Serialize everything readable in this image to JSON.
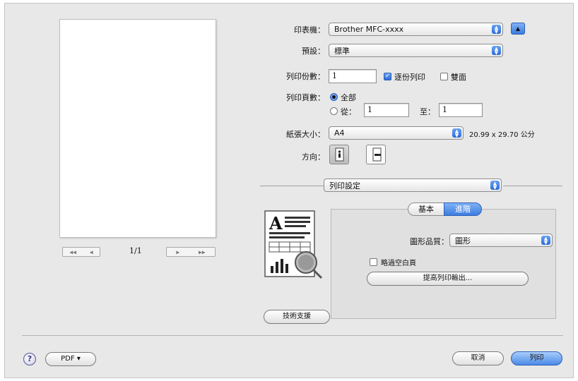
{
  "printer": {
    "label": "印表機：",
    "value": "Brother MFC-xxxx"
  },
  "presets": {
    "label": "預設：",
    "value": "標準"
  },
  "copies": {
    "label": "列印份數：",
    "value": "1",
    "collate_label": "逐份列印",
    "collate_checked": true,
    "duplex_label": "雙面",
    "duplex_checked": false
  },
  "pages": {
    "label": "列印頁數：",
    "all_label": "全部",
    "from_label": "從：",
    "from_value": "1",
    "to_label": "至：",
    "to_value": "1",
    "selected": "all"
  },
  "paper_size": {
    "label": "紙張大小：",
    "value": "A4",
    "dimensions": "20.99 x 29.70 公分"
  },
  "orientation": {
    "label": "方向：",
    "selected": "portrait"
  },
  "panel": {
    "value": "列印設定"
  },
  "preview": {
    "page_indicator": "1/1",
    "nav_first": "◀◀",
    "nav_prev": "◀",
    "nav_next": "▶",
    "nav_last": "▶▶"
  },
  "tabs": [
    {
      "label": "基本",
      "active": false
    },
    {
      "label": "進階",
      "active": true
    }
  ],
  "advanced": {
    "graphics_quality_label": "圖形品質：",
    "graphics_quality_value": "圖形",
    "skip_blank_label": "略過空白頁",
    "skip_blank_checked": false,
    "improve_output_button": "提高列印輸出..."
  },
  "support_button": "技術支援",
  "help_symbol": "?",
  "pdf_button": "PDF ▾",
  "cancel_button": "取消",
  "print_button": "列印",
  "colors": {
    "accent": "#3d7ce0"
  }
}
